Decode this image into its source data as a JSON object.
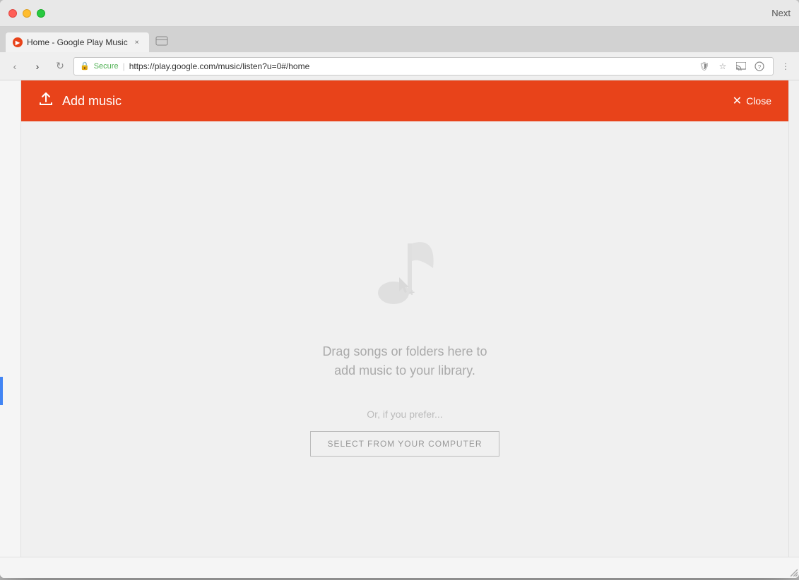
{
  "window": {
    "title": "Home - Google Play Music",
    "next_label": "Next"
  },
  "browser": {
    "tab_title": "Home - Google Play Music",
    "tab_close": "×",
    "new_tab_icon": "+",
    "back_icon": "‹",
    "forward_icon": "›",
    "refresh_icon": "↻",
    "secure_label": "Secure",
    "url": "https://play.google.com/music/listen?u=0#/home",
    "url_action_shield": "🛡",
    "url_action_star": "☆",
    "url_action_cast": "⬛",
    "url_action_menu": "⋮",
    "url_action_extensions": "?"
  },
  "modal": {
    "title": "Add music",
    "close_label": "Close",
    "upload_icon": "↑",
    "drag_text_line1": "Drag songs or folders here to",
    "drag_text_line2": "add music to your library.",
    "prefer_text": "Or, if you prefer...",
    "select_button_label": "SELECT FROM YOUR COMPUTER"
  },
  "colors": {
    "header_bg": "#e8431a",
    "body_bg": "#f0f0f0"
  }
}
